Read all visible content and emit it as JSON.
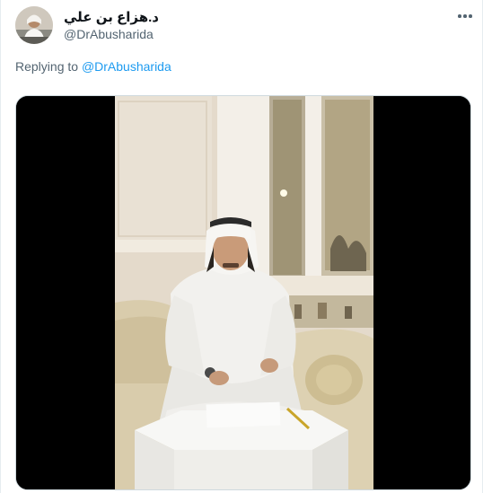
{
  "tweet": {
    "author_name": "د.هزاع بن علي",
    "author_handle": "@DrAbusharida",
    "replying_prefix": "Replying to",
    "replying_to": "@DrAbusharida",
    "more_icon": "more-horizontal-icon"
  },
  "colors": {
    "link": "#1d9bf0",
    "secondary_text": "#536471",
    "border": "#e6ecf0"
  }
}
